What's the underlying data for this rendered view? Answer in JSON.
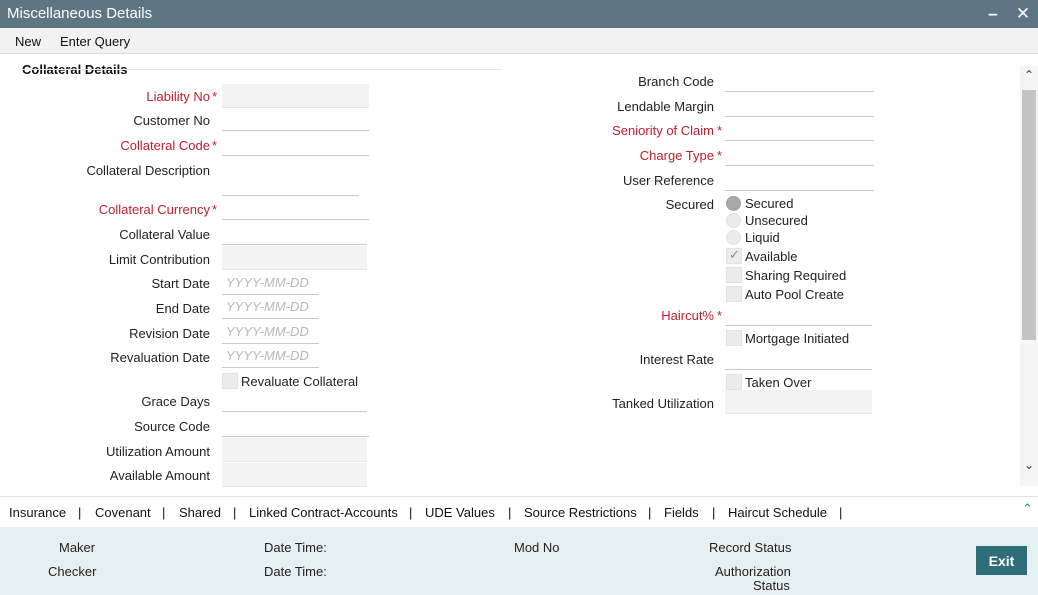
{
  "window": {
    "title": "Miscellaneous Details",
    "minimize_glyph": "–",
    "close_glyph": "✕"
  },
  "menu": {
    "new": "New",
    "enter_query": "Enter Query"
  },
  "section": {
    "title": "Collateral Details"
  },
  "left": {
    "liability_no": "Liability No",
    "customer_no": "Customer No",
    "collateral_code": "Collateral Code",
    "collateral_description": "Collateral Description",
    "collateral_currency": "Collateral Currency",
    "collateral_value": "Collateral Value",
    "limit_contribution": "Limit Contribution",
    "start_date": "Start Date",
    "end_date": "End Date",
    "revision_date": "Revision Date",
    "revaluation_date": "Revaluation Date",
    "revaluate_collateral": "Revaluate Collateral",
    "grace_days": "Grace Days",
    "source_code": "Source Code",
    "utilization_amount": "Utilization Amount",
    "available_amount": "Available Amount",
    "date_placeholder": "YYYY-MM-DD",
    "required_mark": "*"
  },
  "right": {
    "branch_code": "Branch Code",
    "lendable_margin": "Lendable Margin",
    "seniority_of_claim": "Seniority of Claim",
    "charge_type": "Charge Type",
    "user_reference": "User Reference",
    "secured_label": "Secured",
    "secured_options": [
      "Secured",
      "Unsecured",
      "Liquid"
    ],
    "secured_selected": "Secured",
    "available": "Available",
    "sharing_required": "Sharing Required",
    "auto_pool_create": "Auto Pool Create",
    "haircut": "Haircut%",
    "mortgage_initiated": "Mortgage Initiated",
    "interest_rate": "Interest Rate",
    "taken_over": "Taken Over",
    "tanked_utilization": "Tanked Utilization"
  },
  "tabs": [
    "Insurance",
    "Covenant",
    "Shared",
    "Linked Contract-Accounts",
    "UDE Values",
    "Source Restrictions",
    "Fields",
    "Haircut Schedule"
  ],
  "tab_separator": "|",
  "footer": {
    "maker": "Maker",
    "checker": "Checker",
    "date_time_1": "Date Time:",
    "date_time_2": "Date Time:",
    "mod_no": "Mod No",
    "record_status": "Record Status",
    "authorization": "Authorization",
    "status": "Status",
    "exit": "Exit"
  },
  "colors": {
    "titlebar": "#5e7683",
    "required_label": "#c0202f",
    "footer_bg": "#e6f0f3",
    "exit_button": "#2f6d7a",
    "collapse_icon": "#2a8bbf"
  }
}
